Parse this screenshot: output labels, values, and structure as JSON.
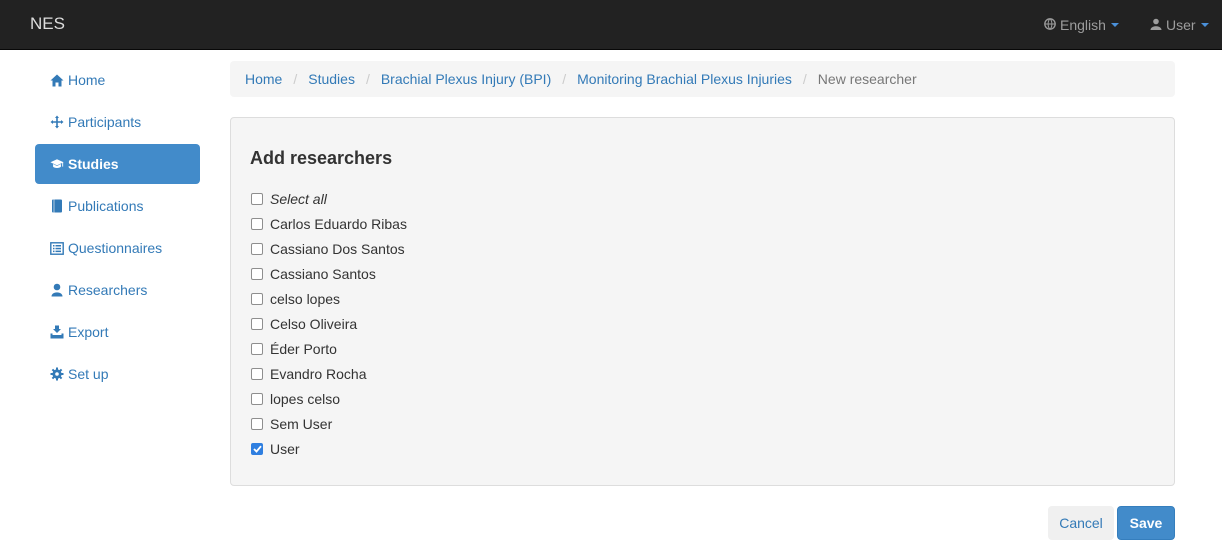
{
  "navbar": {
    "brand": "NES",
    "language_label": "English",
    "user_label": "User",
    "icons": {
      "language": "globe-icon",
      "user": "user-icon"
    }
  },
  "sidebar": {
    "items": [
      {
        "label": "Home",
        "icon": "home-icon",
        "active": false
      },
      {
        "label": "Participants",
        "icon": "move-icon",
        "active": false
      },
      {
        "label": "Studies",
        "icon": "education-icon",
        "active": true
      },
      {
        "label": "Publications",
        "icon": "book-icon",
        "active": false
      },
      {
        "label": "Questionnaires",
        "icon": "list-alt-icon",
        "active": false
      },
      {
        "label": "Researchers",
        "icon": "user-icon",
        "active": false
      },
      {
        "label": "Export",
        "icon": "export-icon",
        "active": false
      },
      {
        "label": "Set up",
        "icon": "cog-icon",
        "active": false
      }
    ]
  },
  "breadcrumb": {
    "items": [
      "Home",
      "Studies",
      "Brachial Plexus Injury (BPI)",
      "Monitoring Brachial Plexus Injuries"
    ],
    "current": "New researcher"
  },
  "panel": {
    "title": "Add researchers",
    "select_all_label": "Select all",
    "researchers": [
      {
        "name": "Carlos Eduardo Ribas",
        "checked": false
      },
      {
        "name": "Cassiano Dos Santos",
        "checked": false
      },
      {
        "name": "Cassiano Santos",
        "checked": false
      },
      {
        "name": "celso lopes",
        "checked": false
      },
      {
        "name": "Celso Oliveira",
        "checked": false
      },
      {
        "name": "Éder Porto",
        "checked": false
      },
      {
        "name": "Evandro Rocha",
        "checked": false
      },
      {
        "name": "lopes celso",
        "checked": false
      },
      {
        "name": "Sem User",
        "checked": false
      },
      {
        "name": "User",
        "checked": true
      }
    ]
  },
  "actions": {
    "cancel_label": "Cancel",
    "save_label": "Save"
  },
  "colors": {
    "navbar_bg": "#222222",
    "link": "#337ab7",
    "primary": "#428bca",
    "panel_bg": "#f5f5f5",
    "checkbox_checked": "#2f7fe0"
  }
}
